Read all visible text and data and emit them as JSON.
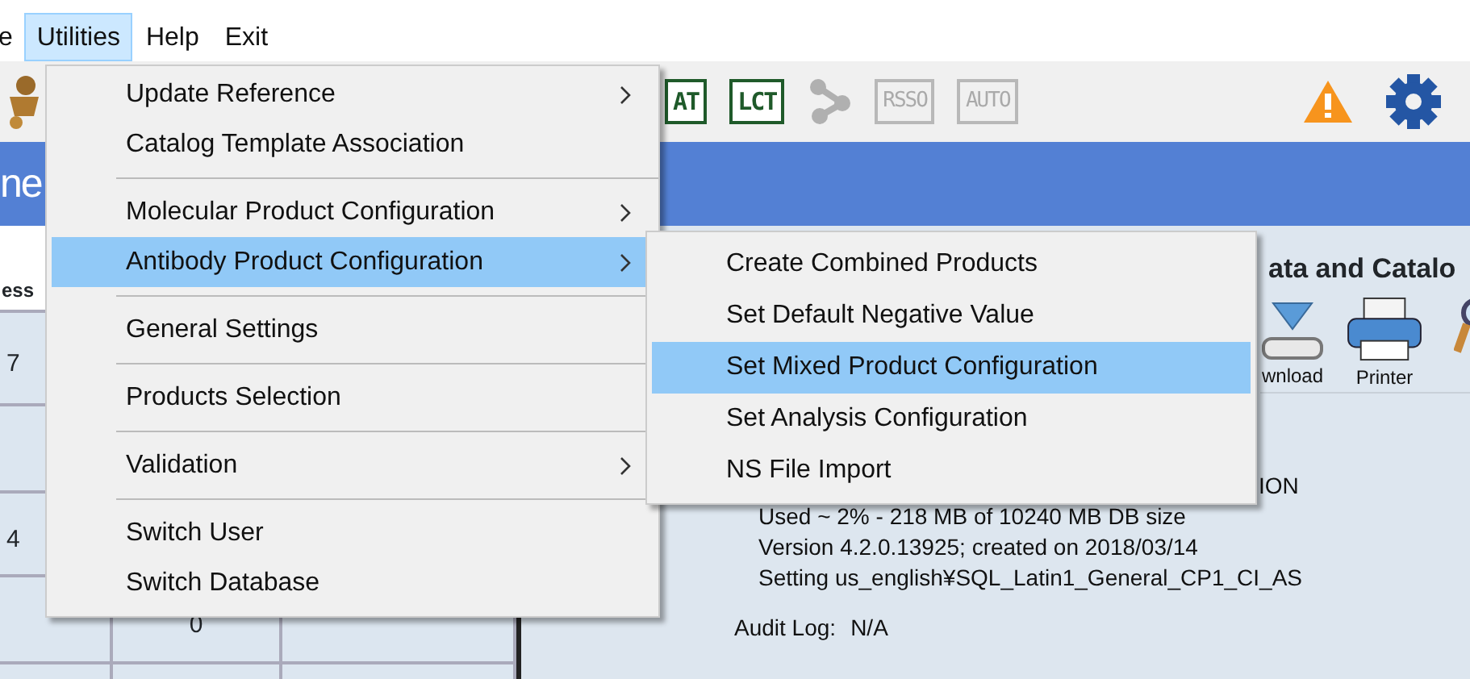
{
  "menu_bar": [
    {
      "label": "e",
      "selected": false
    },
    {
      "label": "Utilities",
      "selected": true
    },
    {
      "label": "Help",
      "selected": false
    },
    {
      "label": "Exit",
      "selected": false
    }
  ],
  "toolbar": [
    {
      "kind": "tag",
      "label": "AT",
      "disabled": false
    },
    {
      "kind": "tag",
      "label": "LCT",
      "disabled": false
    },
    {
      "kind": "share",
      "disabled": true
    },
    {
      "kind": "tag",
      "label": "RSSO",
      "disabled": true
    },
    {
      "kind": "tag",
      "label": "AUTO",
      "disabled": true
    }
  ],
  "header_title": "ne",
  "table": {
    "columns": [
      "ess"
    ],
    "rows": [
      [
        "7",
        null,
        null
      ],
      [
        null,
        null,
        null
      ],
      [
        "4",
        null,
        null
      ],
      [
        null,
        "0",
        null
      ],
      [
        null,
        null,
        null
      ]
    ]
  },
  "panel": {
    "title": "ata and Catalo",
    "tools": [
      {
        "kind": "download",
        "label": "wnload"
      },
      {
        "kind": "printer",
        "label": "Printer"
      },
      {
        "kind": "search"
      }
    ],
    "info_lines": [
      "ION",
      "Used ~ 2% - 218 MB of 10240 MB DB size",
      "Version 4.2.0.13925; created on 2018/03/14",
      "Setting us_english¥SQL_Latin1_General_CP1_CI_AS"
    ],
    "audit_label": "Audit Log:",
    "audit_value": "N/A"
  },
  "utilities_menu": [
    {
      "kind": "item",
      "label": "Update Reference",
      "submenu": true,
      "selected": false
    },
    {
      "kind": "item",
      "label": "Catalog Template Association",
      "submenu": false,
      "selected": false
    },
    {
      "kind": "separator"
    },
    {
      "kind": "item",
      "label": "Molecular Product Configuration",
      "submenu": true,
      "selected": false
    },
    {
      "kind": "item",
      "label": "Antibody Product Configuration",
      "submenu": true,
      "selected": true
    },
    {
      "kind": "separator"
    },
    {
      "kind": "item",
      "label": "General Settings",
      "submenu": false,
      "selected": false
    },
    {
      "kind": "separator"
    },
    {
      "kind": "item",
      "label": "Products Selection",
      "submenu": false,
      "selected": false
    },
    {
      "kind": "separator"
    },
    {
      "kind": "item",
      "label": "Validation",
      "submenu": true,
      "selected": false
    },
    {
      "kind": "separator"
    },
    {
      "kind": "item",
      "label": "Switch User",
      "submenu": false,
      "selected": false
    },
    {
      "kind": "item",
      "label": "Switch Database",
      "submenu": false,
      "selected": false
    }
  ],
  "antibody_submenu": [
    {
      "kind": "item",
      "label": "Create Combined Products",
      "submenu": false,
      "selected": false
    },
    {
      "kind": "item",
      "label": "Set Default Negative Value",
      "submenu": false,
      "selected": false
    },
    {
      "kind": "item",
      "label": "Set Mixed Product Configuration",
      "submenu": false,
      "selected": true
    },
    {
      "kind": "item",
      "label": "Set Analysis Configuration",
      "submenu": false,
      "selected": false
    },
    {
      "kind": "item",
      "label": "NS File Import",
      "submenu": false,
      "selected": false
    }
  ]
}
